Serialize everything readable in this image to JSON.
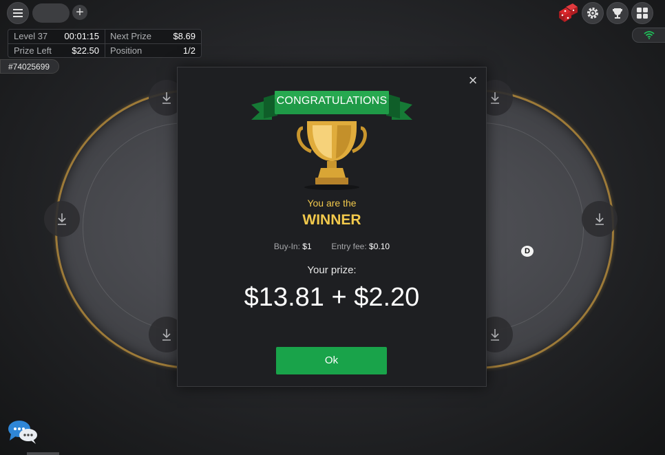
{
  "info_panel": {
    "level_label": "Level 37",
    "timer": "00:01:15",
    "next_prize_label": "Next Prize",
    "next_prize_value": "$8.69",
    "prize_left_label": "Prize Left",
    "prize_left_value": "$22.50",
    "position_label": "Position",
    "position_value": "1/2"
  },
  "table_id": "#74025699",
  "toolbar_icons": [
    "menu-icon",
    "add-icon",
    "dice-icon",
    "settings-icon",
    "trophy-icon",
    "grid-icon",
    "wifi-icon"
  ],
  "dealer_button": "D",
  "modal": {
    "ribbon_text": "CONGRATULATIONS",
    "you_are": "You are the",
    "winner": "WINNER",
    "buy_in_label": "Buy-In:",
    "buy_in_value": "$1",
    "entry_fee_label": "Entry fee:",
    "entry_fee_value": "$0.10",
    "your_prize_label": "Your prize:",
    "prize_value": "$13.81 + $2.20",
    "ok_label": "Ok"
  },
  "colors": {
    "accent_gold": "#f2c94c",
    "ok_green": "#19a34a",
    "ribbon_green": "#1f9a47",
    "table_rim": "#9d7a38"
  }
}
